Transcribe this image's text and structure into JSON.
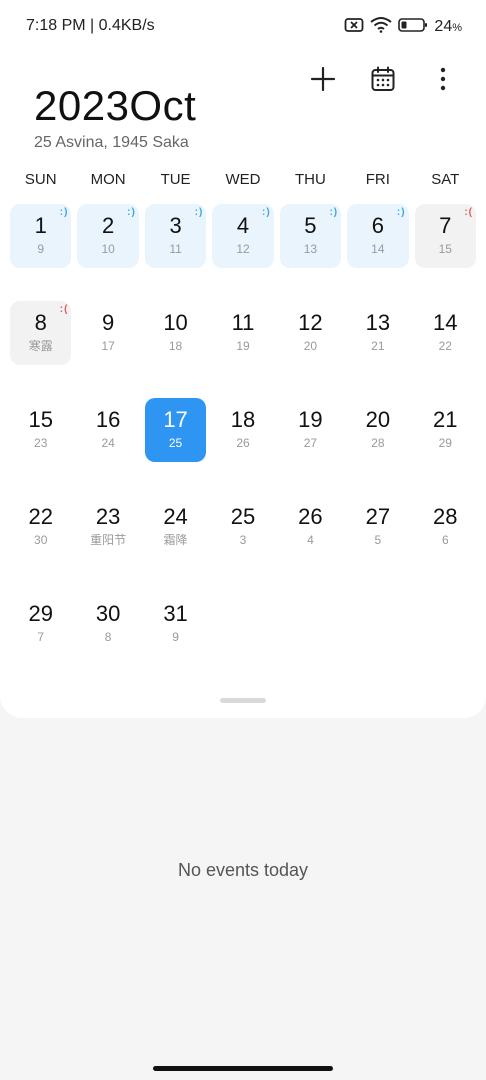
{
  "status_bar": {
    "time_speed": "7:18 PM | 0.4KB/s",
    "battery_percent": "24",
    "battery_unit": "%",
    "icons": [
      "sim-error-icon",
      "wifi-icon",
      "battery-icon"
    ]
  },
  "toolbar": {
    "icons": [
      "plus-icon",
      "calendar-icon",
      "more-vert-icon"
    ]
  },
  "header": {
    "title": "2023Oct",
    "subtitle": "25 Asvina, 1945 Saka"
  },
  "weekdays": [
    "SUN",
    "MON",
    "TUE",
    "WED",
    "THU",
    "FRI",
    "SAT"
  ],
  "days": [
    {
      "day": "1",
      "sub": "9",
      "type": "work",
      "tag": ":)"
    },
    {
      "day": "2",
      "sub": "10",
      "type": "work",
      "tag": ":)"
    },
    {
      "day": "3",
      "sub": "11",
      "type": "work",
      "tag": ":)"
    },
    {
      "day": "4",
      "sub": "12",
      "type": "work",
      "tag": ":)"
    },
    {
      "day": "5",
      "sub": "13",
      "type": "work",
      "tag": ":)"
    },
    {
      "day": "6",
      "sub": "14",
      "type": "work",
      "tag": ":)"
    },
    {
      "day": "7",
      "sub": "15",
      "type": "rest",
      "tag": ":("
    },
    {
      "day": "8",
      "sub": "寒露",
      "type": "rest",
      "tag": ":("
    },
    {
      "day": "9",
      "sub": "17",
      "type": "",
      "tag": ""
    },
    {
      "day": "10",
      "sub": "18",
      "type": "",
      "tag": ""
    },
    {
      "day": "11",
      "sub": "19",
      "type": "",
      "tag": ""
    },
    {
      "day": "12",
      "sub": "20",
      "type": "",
      "tag": ""
    },
    {
      "day": "13",
      "sub": "21",
      "type": "",
      "tag": ""
    },
    {
      "day": "14",
      "sub": "22",
      "type": "",
      "tag": ""
    },
    {
      "day": "15",
      "sub": "23",
      "type": "",
      "tag": ""
    },
    {
      "day": "16",
      "sub": "24",
      "type": "",
      "tag": ""
    },
    {
      "day": "17",
      "sub": "25",
      "type": "today",
      "tag": ""
    },
    {
      "day": "18",
      "sub": "26",
      "type": "",
      "tag": ""
    },
    {
      "day": "19",
      "sub": "27",
      "type": "",
      "tag": ""
    },
    {
      "day": "20",
      "sub": "28",
      "type": "",
      "tag": ""
    },
    {
      "day": "21",
      "sub": "29",
      "type": "",
      "tag": ""
    },
    {
      "day": "22",
      "sub": "30",
      "type": "",
      "tag": ""
    },
    {
      "day": "23",
      "sub": "重阳节",
      "type": "",
      "tag": ""
    },
    {
      "day": "24",
      "sub": "霜降",
      "type": "",
      "tag": ""
    },
    {
      "day": "25",
      "sub": "3",
      "type": "",
      "tag": ""
    },
    {
      "day": "26",
      "sub": "4",
      "type": "",
      "tag": ""
    },
    {
      "day": "27",
      "sub": "5",
      "type": "",
      "tag": ""
    },
    {
      "day": "28",
      "sub": "6",
      "type": "",
      "tag": ""
    },
    {
      "day": "29",
      "sub": "7",
      "type": "",
      "tag": ""
    },
    {
      "day": "30",
      "sub": "8",
      "type": "",
      "tag": ""
    },
    {
      "day": "31",
      "sub": "9",
      "type": "",
      "tag": ""
    }
  ],
  "events": {
    "empty_message": "No events today"
  },
  "colors": {
    "accent": "#2f95f2",
    "work_bg": "#eaf4fd",
    "rest_bg": "#f2f2f2",
    "work_tag": "#39a6e6",
    "rest_tag": "#e05a5a"
  }
}
